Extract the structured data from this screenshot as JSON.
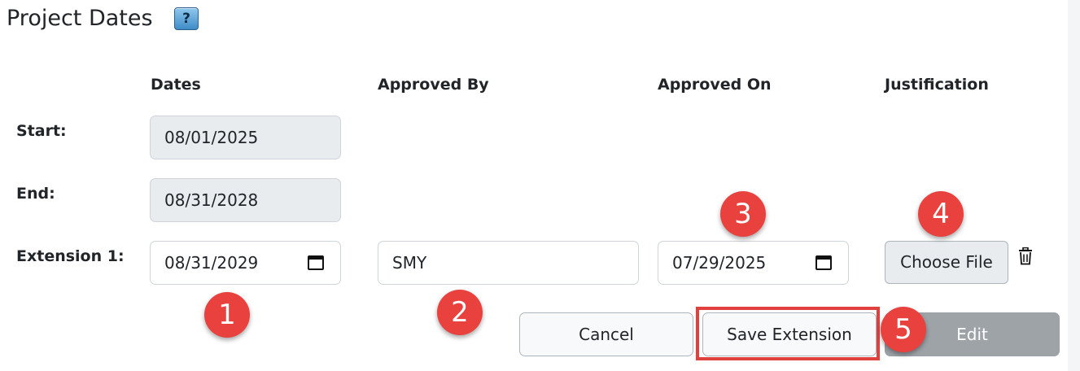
{
  "section": {
    "title": "Project Dates",
    "help_icon_glyph": "?"
  },
  "columns": {
    "dates": "Dates",
    "approved_by": "Approved By",
    "approved_on": "Approved On",
    "justification": "Justification"
  },
  "rows": {
    "start": {
      "label": "Start:",
      "date": "08/01/2025"
    },
    "end": {
      "label": "End:",
      "date": "08/31/2028"
    },
    "extension": {
      "label": "Extension 1:",
      "date": "08/31/2029",
      "approved_by": "SMY",
      "approved_on": "07/29/2025",
      "file_button_label": "Choose File"
    }
  },
  "actions": {
    "cancel_label": "Cancel",
    "save_label": "Save Extension",
    "edit_label": "Edit"
  },
  "markers": [
    "1",
    "2",
    "3",
    "4",
    "5"
  ],
  "colors": {
    "marker": "#e8413e",
    "highlight_border": "#e0413f",
    "disabled_field": "#e9ecef",
    "edit_button": "#9ea3a8"
  },
  "icons": {
    "help": "help-icon",
    "calendar": "calendar-icon",
    "trash": "trash-icon"
  }
}
